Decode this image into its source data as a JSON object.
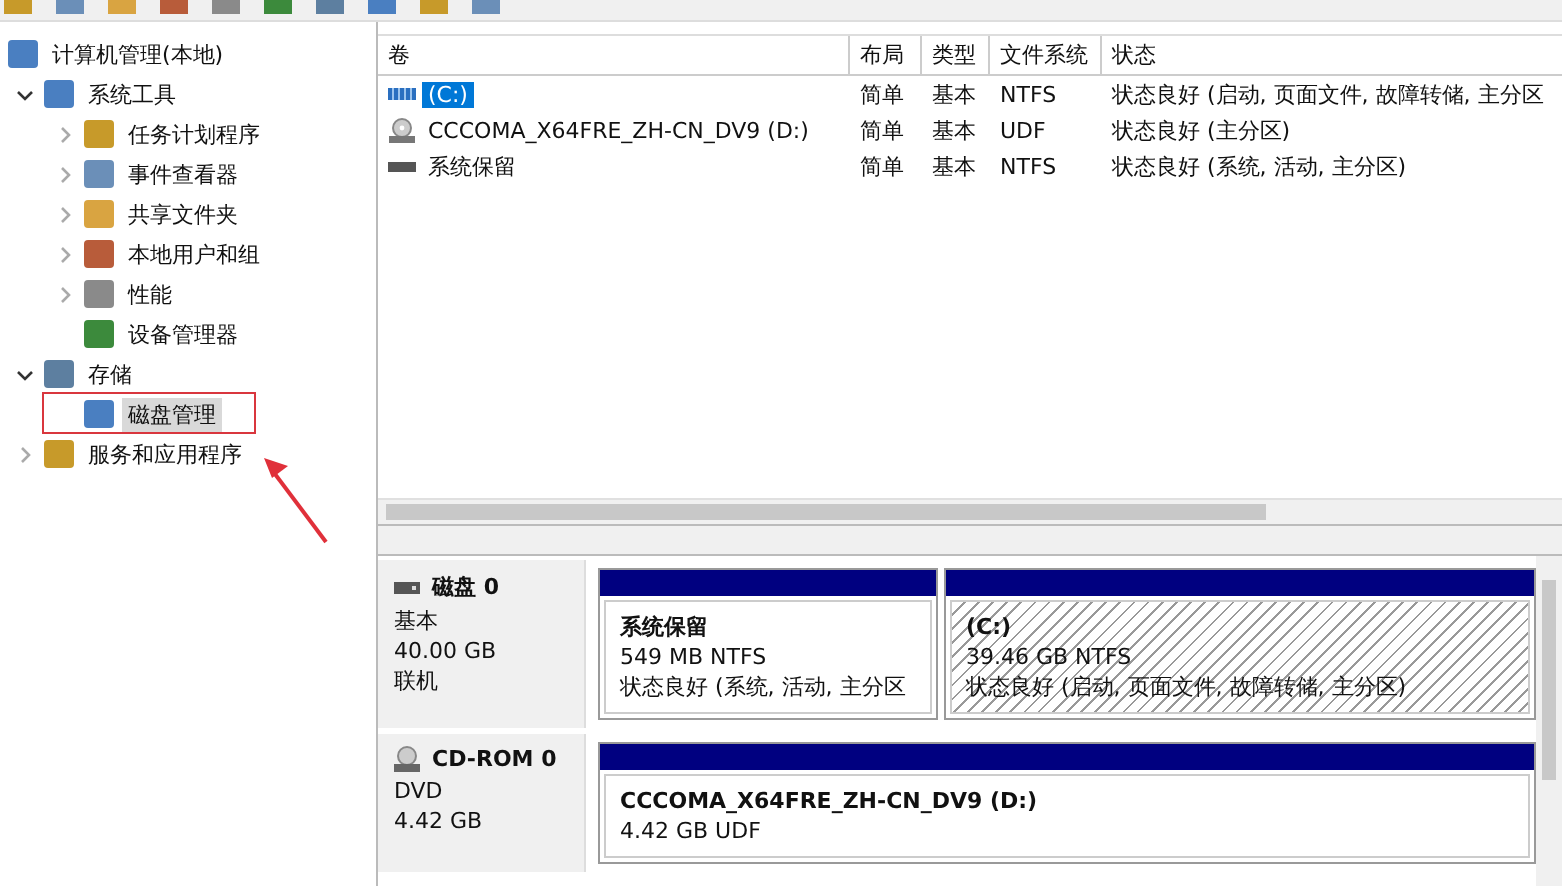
{
  "tree": {
    "label": "计算机管理(本地)",
    "selected": false,
    "children": [
      {
        "label": "系统工具",
        "expanded": true,
        "selected": false,
        "children": [
          {
            "label": "任务计划程序",
            "expanded": false,
            "selected": false
          },
          {
            "label": "事件查看器",
            "expanded": false,
            "selected": false
          },
          {
            "label": "共享文件夹",
            "expanded": false,
            "selected": false
          },
          {
            "label": "本地用户和组",
            "expanded": false,
            "selected": false
          },
          {
            "label": "性能",
            "expanded": false,
            "selected": false
          },
          {
            "label": "设备管理器",
            "selected": false
          }
        ]
      },
      {
        "label": "存储",
        "expanded": true,
        "selected": false,
        "children": [
          {
            "label": "磁盘管理",
            "selected": true
          }
        ]
      },
      {
        "label": "服务和应用程序",
        "expanded": false,
        "selected": false
      }
    ]
  },
  "volumes": {
    "columns": [
      "卷",
      "布局",
      "类型",
      "文件系统",
      "状态"
    ],
    "rows": [
      {
        "kind": "hdd",
        "selected": true,
        "cells": [
          "(C:)",
          "简单",
          "基本",
          "NTFS",
          "状态良好 (启动, 页面文件, 故障转储, 主分区"
        ]
      },
      {
        "kind": "dvd",
        "selected": false,
        "cells": [
          "CCCOMA_X64FRE_ZH-CN_DV9 (D:)",
          "简单",
          "基本",
          "UDF",
          "状态良好 (主分区)"
        ]
      },
      {
        "kind": "plain",
        "selected": false,
        "cells": [
          "系统保留",
          "简单",
          "基本",
          "NTFS",
          "状态良好 (系统, 活动, 主分区)"
        ]
      }
    ]
  },
  "disks": [
    {
      "kind": "disk",
      "name": "磁盘 0",
      "lines": [
        "基本",
        "40.00 GB",
        "联机"
      ],
      "partitions": [
        {
          "title": "系统保留",
          "selected": false,
          "lines": [
            "549 MB NTFS",
            "状态良好 (系统, 活动, 主分区"
          ]
        },
        {
          "title": "(C:)",
          "selected": true,
          "lines": [
            "39.46 GB NTFS",
            "状态良好 (启动, 页面文件, 故障转储, 主分区)"
          ]
        }
      ]
    },
    {
      "kind": "cdrom",
      "name": "CD-ROM 0",
      "lines": [
        "DVD",
        "4.42 GB"
      ],
      "partitions": [
        {
          "title": "CCCOMA_X64FRE_ZH-CN_DV9  (D:)",
          "selected": false,
          "lines": [
            "4.42 GB UDF"
          ]
        }
      ]
    }
  ]
}
